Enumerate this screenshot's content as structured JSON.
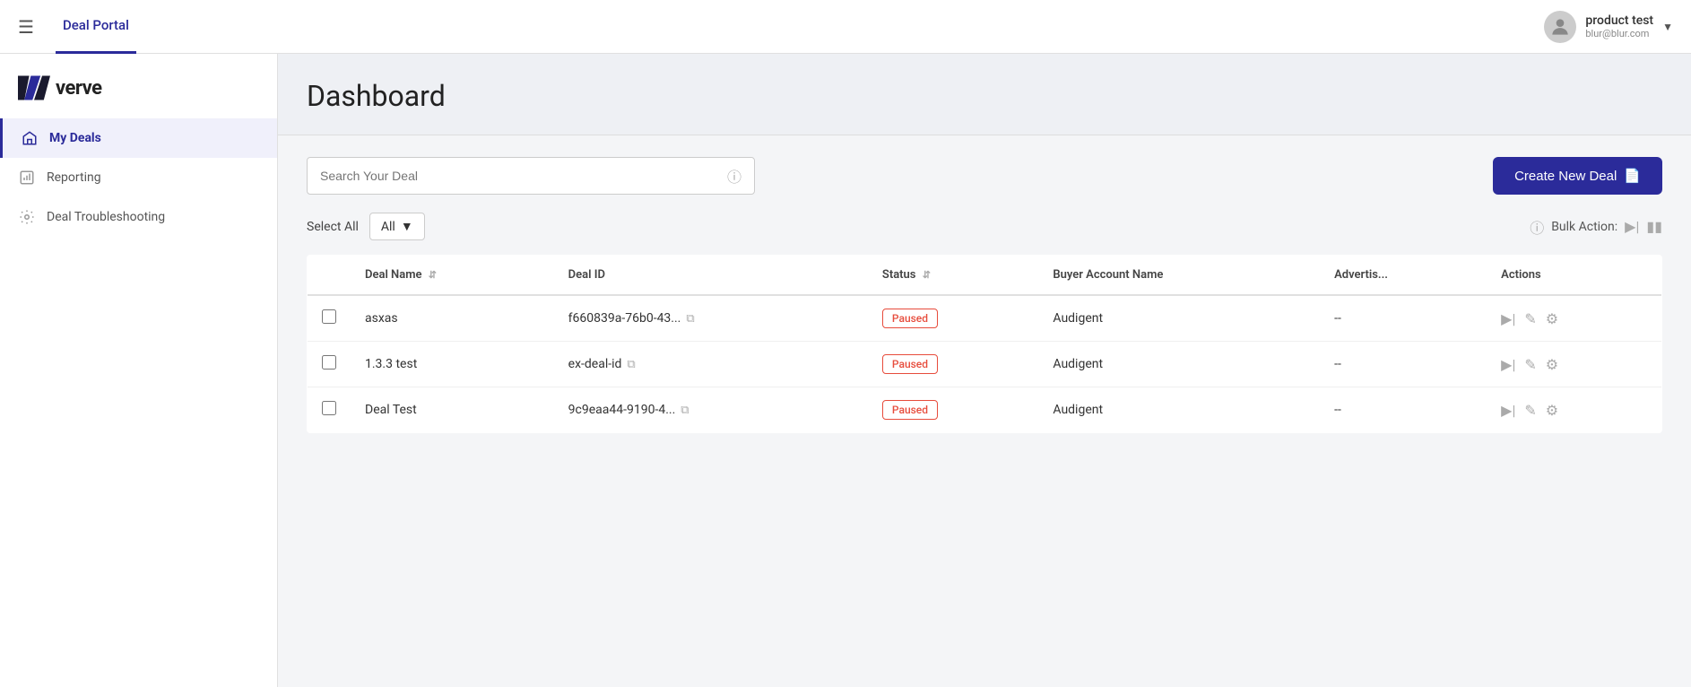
{
  "topNav": {
    "tab": "Deal Portal",
    "user": {
      "name": "product test",
      "email": "blur@blur.com"
    }
  },
  "sidebar": {
    "logo": "verve",
    "items": [
      {
        "id": "my-deals",
        "label": "My Deals",
        "icon": "home",
        "active": true
      },
      {
        "id": "reporting",
        "label": "Reporting",
        "icon": "report",
        "active": false
      },
      {
        "id": "deal-troubleshooting",
        "label": "Deal Troubleshooting",
        "icon": "settings",
        "active": false
      }
    ]
  },
  "dashboard": {
    "title": "Dashboard"
  },
  "search": {
    "placeholder": "Search Your Deal"
  },
  "createButton": {
    "label": "Create New Deal"
  },
  "filter": {
    "selectAllLabel": "Select All",
    "dropdownValue": "All",
    "bulkActionLabel": "Bulk Action:"
  },
  "table": {
    "columns": [
      {
        "key": "dealName",
        "label": "Deal Name"
      },
      {
        "key": "dealId",
        "label": "Deal ID"
      },
      {
        "key": "status",
        "label": "Status"
      },
      {
        "key": "buyerAccountName",
        "label": "Buyer Account Name"
      },
      {
        "key": "advertiser",
        "label": "Advertis..."
      },
      {
        "key": "actions",
        "label": "Actions"
      }
    ],
    "rows": [
      {
        "dealName": "asxas",
        "dealId": "f660839a-76b0-43...",
        "status": "Paused",
        "buyerAccountName": "Audigent",
        "advertiser": "--"
      },
      {
        "dealName": "1.3.3 test",
        "dealId": "ex-deal-id",
        "status": "Paused",
        "buyerAccountName": "Audigent",
        "advertiser": "--"
      },
      {
        "dealName": "Deal Test",
        "dealId": "9c9eaa44-9190-4...",
        "status": "Paused",
        "buyerAccountName": "Audigent",
        "advertiser": "--"
      }
    ]
  }
}
